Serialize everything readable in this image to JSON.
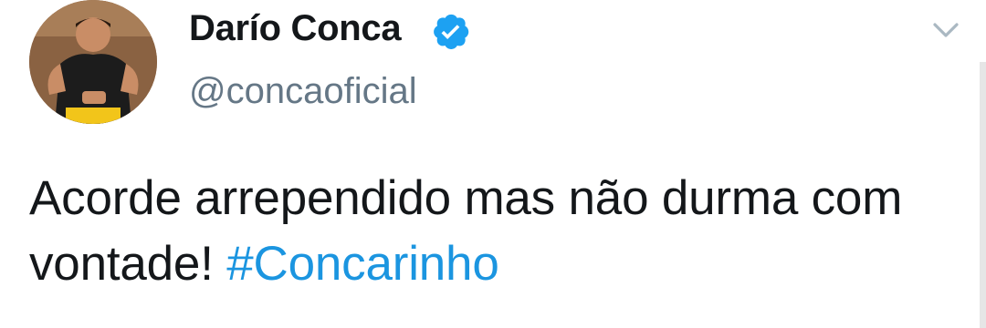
{
  "author": {
    "display_name": "Darío Conca",
    "handle": "@concaoficial",
    "verified": true,
    "avatar_icon": "profile-photo"
  },
  "tweet": {
    "text": "Acorde arrependido mas não durma com vontade!",
    "hashtag": "#Concarinho"
  },
  "icons": {
    "verified": "verified-badge-icon",
    "menu": "chevron-down-icon"
  },
  "colors": {
    "verified_blue": "#1da1f2",
    "link_blue": "#1b95e0",
    "text_dark": "#14171a",
    "text_gray": "#657786"
  }
}
